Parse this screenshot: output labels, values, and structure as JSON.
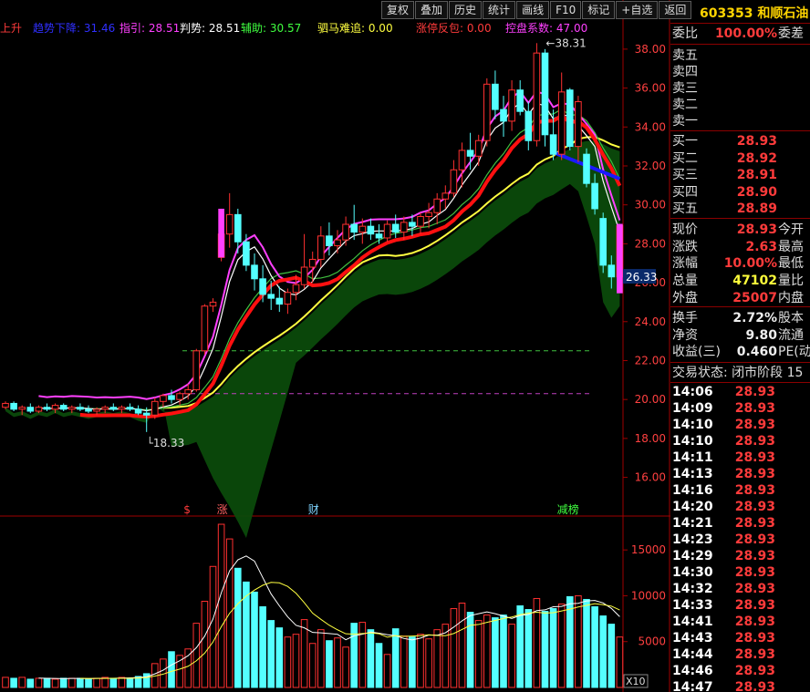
{
  "toolbar": [
    "复权",
    "叠加",
    "历史",
    "统计",
    "画线",
    "F10",
    "标记",
    "+自选",
    "返回"
  ],
  "indicators": [
    {
      "text": "上升",
      "color": "#ff3b3b"
    },
    {
      "text": "趋势下降: 31.46",
      "color": "#2f2fff"
    },
    {
      "text": "指引: 28.51",
      "color": "#ff40ff"
    },
    {
      "text": "判势: 28.51",
      "color": "#ffffff"
    },
    {
      "text": "辅助: 30.57",
      "color": "#40ff40"
    },
    {
      "text": "驷马难追: 0.00",
      "color": "#ffff40"
    },
    {
      "text": "涨停反包: 0.00",
      "color": "#ff3b3b"
    },
    {
      "text": "控盘系数: 47.00",
      "color": "#ff40ff"
    }
  ],
  "stock": {
    "code": "603353",
    "name": "和顺石油"
  },
  "quote": {
    "wei_bi_label": "委比",
    "wei_bi": "100.00%",
    "wei_cha_label": "委差",
    "sell": [
      {
        "label": "卖五",
        "price": ""
      },
      {
        "label": "卖四",
        "price": ""
      },
      {
        "label": "卖三",
        "price": ""
      },
      {
        "label": "卖二",
        "price": ""
      },
      {
        "label": "卖一",
        "price": ""
      }
    ],
    "buy": [
      {
        "label": "买一",
        "price": "28.93"
      },
      {
        "label": "买二",
        "price": "28.92"
      },
      {
        "label": "买三",
        "price": "28.91"
      },
      {
        "label": "买四",
        "price": "28.90"
      },
      {
        "label": "买五",
        "price": "28.89"
      }
    ],
    "stats": [
      {
        "label": "现价",
        "value": "28.93",
        "label2": "今开",
        "color": "red"
      },
      {
        "label": "涨跌",
        "value": "2.63",
        "label2": "最高",
        "color": "red"
      },
      {
        "label": "涨幅",
        "value": "10.00%",
        "label2": "最低",
        "color": "red"
      },
      {
        "label": "总量",
        "value": "47102",
        "label2": "量比",
        "color": "yel"
      },
      {
        "label": "外盘",
        "value": "25007",
        "label2": "内盘",
        "color": "red"
      }
    ],
    "stats2": [
      {
        "label": "换手",
        "value": "2.72%",
        "label2": "股本",
        "color": "wht"
      },
      {
        "label": "净资",
        "value": "9.80",
        "label2": "流通",
        "color": "wht"
      },
      {
        "label": "收益(三)",
        "value": "0.460",
        "label2": "PE(动",
        "color": "wht"
      }
    ],
    "trade_state": "交易状态: 闭市阶段 15"
  },
  "ticks": [
    {
      "time": "14:06",
      "price": "28.93"
    },
    {
      "time": "14:09",
      "price": "28.93"
    },
    {
      "time": "14:10",
      "price": "28.93"
    },
    {
      "time": "14:10",
      "price": "28.93"
    },
    {
      "time": "14:11",
      "price": "28.93"
    },
    {
      "time": "14:13",
      "price": "28.93"
    },
    {
      "time": "14:16",
      "price": "28.93"
    },
    {
      "time": "14:20",
      "price": "28.93"
    },
    {
      "time": "14:21",
      "price": "28.93"
    },
    {
      "time": "14:23",
      "price": "28.93"
    },
    {
      "time": "14:29",
      "price": "28.93"
    },
    {
      "time": "14:30",
      "price": "28.93"
    },
    {
      "time": "14:32",
      "price": "28.93"
    },
    {
      "time": "14:33",
      "price": "28.93"
    },
    {
      "time": "14:41",
      "price": "28.93"
    },
    {
      "time": "14:43",
      "price": "28.93"
    },
    {
      "time": "14:44",
      "price": "28.93"
    },
    {
      "time": "14:46",
      "price": "28.93"
    },
    {
      "time": "14:47",
      "price": "28.93"
    }
  ],
  "chart_data": {
    "type": "candlestick",
    "price_axis": {
      "ticks": [
        16,
        18,
        20,
        22,
        24,
        26,
        28,
        30,
        32,
        34,
        36,
        38
      ],
      "range": [
        14.2,
        39.4
      ]
    },
    "volume_axis": {
      "ticks": [
        5000,
        10000,
        15000
      ],
      "range": [
        0,
        18200
      ],
      "unit": "X10"
    },
    "crosshair_price": "26.33",
    "high_label": "38.31",
    "low_label": "18.33",
    "ref_lines": [
      {
        "value": 22.5,
        "color": "#3fbf3f"
      },
      {
        "value": 20.3,
        "color": "#c040c0"
      }
    ],
    "event_markers": [
      {
        "text": "$",
        "color": "#ff3b3b",
        "bar": 22
      },
      {
        "text": "涨",
        "color": "#ff6060",
        "bar": 26
      },
      {
        "text": "财",
        "color": "#7fd4ff",
        "bar": 37
      },
      {
        "text": "减榜",
        "color": "#40ff40",
        "bar": 67
      }
    ],
    "ohlc": [
      [
        19.6,
        19.9,
        19.5,
        19.8
      ],
      [
        19.8,
        19.9,
        19.4,
        19.5
      ],
      [
        19.5,
        19.7,
        19.2,
        19.6
      ],
      [
        19.6,
        19.8,
        19.3,
        19.4
      ],
      [
        19.4,
        19.7,
        19.3,
        19.6
      ],
      [
        19.6,
        19.8,
        19.4,
        19.5
      ],
      [
        19.5,
        19.8,
        19.3,
        19.7
      ],
      [
        19.7,
        19.8,
        19.4,
        19.5
      ],
      [
        19.5,
        19.7,
        19.3,
        19.6
      ],
      [
        19.6,
        19.8,
        19.4,
        19.5
      ],
      [
        19.5,
        19.7,
        19.3,
        19.4
      ],
      [
        19.4,
        19.6,
        19.2,
        19.5
      ],
      [
        19.5,
        19.7,
        19.3,
        19.6
      ],
      [
        19.6,
        19.8,
        19.4,
        19.5
      ],
      [
        19.5,
        19.7,
        19.3,
        19.6
      ],
      [
        19.6,
        19.8,
        19.4,
        19.5
      ],
      [
        19.5,
        19.7,
        19.2,
        19.3
      ],
      [
        19.3,
        19.6,
        18.33,
        19.2
      ],
      [
        19.2,
        20.1,
        19.0,
        19.9
      ],
      [
        19.9,
        20.3,
        19.6,
        20.2
      ],
      [
        20.2,
        20.5,
        19.8,
        20.0
      ],
      [
        20.0,
        20.4,
        19.7,
        20.3
      ],
      [
        20.3,
        20.8,
        20.0,
        20.5
      ],
      [
        20.5,
        22.6,
        20.4,
        22.5
      ],
      [
        22.5,
        24.9,
        22.3,
        24.8
      ],
      [
        24.8,
        25.2,
        24.5,
        25.0
      ],
      [
        27.3,
        29.8,
        27.1,
        28.5
      ],
      [
        28.5,
        30.6,
        27.8,
        29.5
      ],
      [
        29.5,
        29.8,
        27.5,
        28.1
      ],
      [
        28.1,
        28.5,
        26.6,
        26.9
      ],
      [
        26.9,
        27.5,
        25.6,
        26.2
      ],
      [
        26.2,
        26.9,
        25.0,
        25.4
      ],
      [
        25.4,
        26.1,
        24.6,
        25.2
      ],
      [
        25.2,
        25.8,
        24.5,
        24.9
      ],
      [
        24.9,
        25.7,
        24.4,
        25.5
      ],
      [
        25.5,
        26.4,
        25.1,
        25.9
      ],
      [
        25.9,
        28.5,
        25.7,
        26.8
      ],
      [
        26.8,
        27.6,
        26.0,
        27.2
      ],
      [
        27.2,
        28.9,
        26.8,
        28.4
      ],
      [
        28.4,
        29.1,
        27.4,
        27.9
      ],
      [
        27.9,
        28.7,
        27.5,
        28.2
      ],
      [
        28.2,
        29.4,
        27.9,
        29.0
      ],
      [
        29.0,
        30.0,
        28.2,
        28.6
      ],
      [
        28.6,
        29.3,
        28.0,
        28.9
      ],
      [
        28.9,
        29.3,
        28.2,
        28.5
      ],
      [
        28.5,
        29.0,
        28.0,
        28.3
      ],
      [
        28.3,
        29.2,
        28.1,
        29.0
      ],
      [
        29.0,
        29.5,
        28.3,
        28.6
      ],
      [
        28.6,
        29.4,
        28.2,
        29.1
      ],
      [
        29.1,
        29.5,
        28.4,
        28.9
      ],
      [
        28.9,
        29.6,
        28.5,
        29.4
      ],
      [
        29.4,
        30.1,
        28.8,
        29.6
      ],
      [
        29.6,
        30.6,
        29.0,
        30.3
      ],
      [
        30.3,
        31.0,
        29.8,
        30.6
      ],
      [
        30.6,
        32.3,
        30.4,
        31.8
      ],
      [
        31.8,
        33.2,
        30.9,
        32.8
      ],
      [
        32.8,
        33.7,
        31.8,
        32.5
      ],
      [
        32.5,
        33.6,
        32.0,
        33.3
      ],
      [
        33.3,
        36.5,
        33.0,
        36.2
      ],
      [
        36.2,
        36.9,
        34.4,
        34.9
      ],
      [
        34.9,
        35.6,
        33.5,
        34.3
      ],
      [
        34.3,
        36.4,
        33.8,
        35.9
      ],
      [
        35.9,
        36.4,
        34.6,
        34.8
      ],
      [
        34.8,
        35.3,
        32.8,
        33.3
      ],
      [
        33.3,
        38.31,
        33.0,
        37.8
      ],
      [
        37.8,
        38.0,
        33.0,
        33.6
      ],
      [
        33.6,
        34.9,
        32.3,
        32.6
      ],
      [
        32.6,
        36.8,
        32.3,
        35.8
      ],
      [
        35.9,
        36.0,
        32.8,
        33.0
      ],
      [
        33.0,
        35.6,
        32.2,
        35.3
      ],
      [
        32.6,
        32.9,
        30.9,
        31.1
      ],
      [
        31.1,
        31.6,
        29.5,
        29.8
      ],
      [
        29.3,
        29.6,
        26.5,
        26.9
      ],
      [
        26.9,
        27.4,
        25.7,
        26.3
      ],
      [
        26.3,
        28.93,
        26.3,
        28.93
      ]
    ],
    "volume": [
      1100,
      1000,
      1100,
      900,
      1000,
      1000,
      900,
      1000,
      1000,
      1000,
      900,
      1000,
      1100,
      1000,
      1100,
      1000,
      1200,
      1500,
      2600,
      3100,
      3900,
      3500,
      4200,
      7000,
      9400,
      13200,
      17800,
      16200,
      13000,
      11500,
      10400,
      8800,
      7300,
      6500,
      5500,
      5800,
      7400,
      4800,
      6300,
      5100,
      5400,
      4400,
      7000,
      7100,
      6300,
      4800,
      3600,
      6400,
      5600,
      5500,
      5800,
      5300,
      6300,
      6900,
      8600,
      9200,
      8200,
      7300,
      7900,
      7600,
      7900,
      6900,
      8900,
      8500,
      9700,
      8300,
      8600,
      9100,
      9900,
      10000,
      9600,
      8800,
      7800,
      6900,
      5500
    ]
  }
}
